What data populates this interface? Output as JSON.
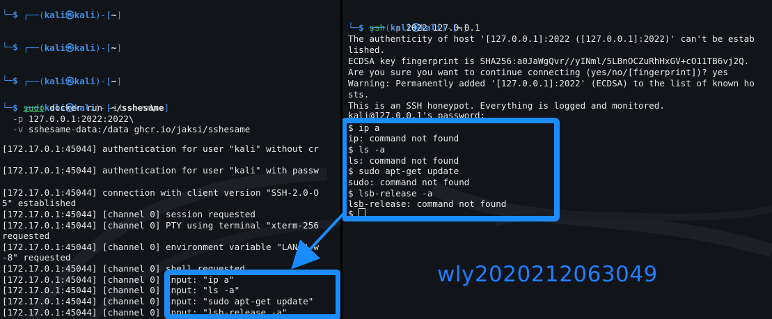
{
  "prompt": {
    "user": "kali",
    "at": "㉿",
    "host": "kali",
    "home": "~",
    "dir_sshesame": "~/sshesame",
    "dollar": "$"
  },
  "left": {
    "cmd_sudo": "sudo",
    "cmd_rest": " docker run ",
    "flag_it": "-it",
    "flag_rm": " --rm",
    "backslash1": "\\",
    "flag_p": "-p",
    "port_map": " 127.0.0.1:2022:2022\\",
    "flag_v": "-v",
    "vol": " sshesame-data:/data ghcr.io/jaksi/sshesame",
    "logs": [
      "[172.17.0.1:45044] authentication for user \"kali\" without cr",
      "[172.17.0.1:45044] authentication for user \"kali\" with passw",
      "[172.17.0.1:45044] connection with client version \"SSH-2.0-O",
      "5\" established",
      "[172.17.0.1:45044] [channel 0] session requested",
      "[172.17.0.1:45044] [channel 0] PTY using terminal \"xterm-256",
      "requested",
      "[172.17.0.1:45044] [channel 0] environment variable \"LANG\" w",
      "-8\" requested",
      "[172.17.0.1:45044] [channel 0] shell requested",
      "[172.17.0.1:45044] [channel 0] input: \"ip a\"",
      "[172.17.0.1:45044] [channel 0] input: \"ls -a\"",
      "[172.17.0.1:45044] [channel 0] input: \"sudo apt-get update\"",
      "[172.17.0.1:45044] [channel 0] input: \"lsb-release -a\""
    ]
  },
  "right": {
    "ssh_cmd": "ssh",
    "ssh_flag": " -p",
    "ssh_args": " 2022 127.0.0.1",
    "lines": [
      "The authenticity of host '[127.0.0.1]:2022 ([127.0.0.1]:2022)' can't be estab",
      "lished.",
      "ECDSA key fingerprint is SHA256:a0JaWgQvr//yINml/5LBnOCZuRhHxGV+cO11TB6vj2Q.",
      "Are you sure you want to continue connecting (yes/no/[fingerprint])? yes",
      "Warning: Permanently added '[127.0.0.1]:2022' (ECDSA) to the list of known ho",
      "sts.",
      "This is an SSH honeypot. Everything is logged and monitored.",
      "kali@127.0.0.1's password:",
      "$ ip a",
      "ip: command not found",
      "$ ls -a",
      "ls: command not found",
      "$ sudo apt-get update",
      "sudo: command not found",
      "$ lsb-release -a",
      "lsb-release: command not found",
      "$ "
    ]
  },
  "watermark": "wly2020212063049",
  "colors": {
    "highlight": "#1a8cff",
    "prompt": "#3b8eea",
    "watermark": "#1f7fff"
  }
}
